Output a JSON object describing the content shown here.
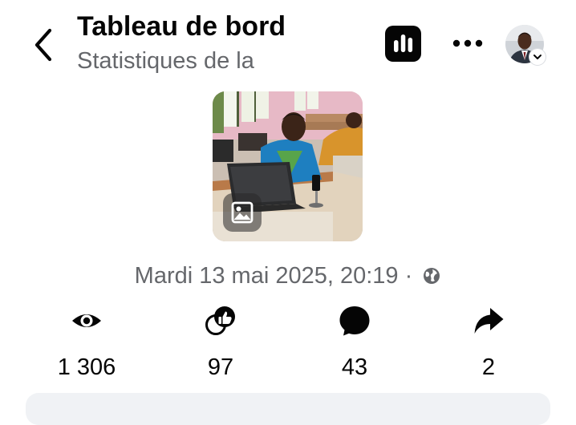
{
  "header": {
    "title": "Tableau de bord",
    "subtitle": "Statistiques de la",
    "back_icon": "chevron-left-icon",
    "insights_icon": "bar-chart-icon",
    "more_icon": "more-dots-icon"
  },
  "post": {
    "thumbnail_badge_icon": "photo-icon",
    "date": "Mardi 13 mai 2025, 20:19",
    "separator": "·",
    "privacy_icon": "globe-icon"
  },
  "stats": [
    {
      "icon": "eye-icon",
      "value": "1 306"
    },
    {
      "icon": "reactions-icon",
      "value": "97"
    },
    {
      "icon": "comment-icon",
      "value": "43"
    },
    {
      "icon": "share-icon",
      "value": "2"
    }
  ],
  "colors": {
    "text": "#050505",
    "secondary_text": "#65676b",
    "background": "#ffffff",
    "card": "#f0f2f5"
  }
}
